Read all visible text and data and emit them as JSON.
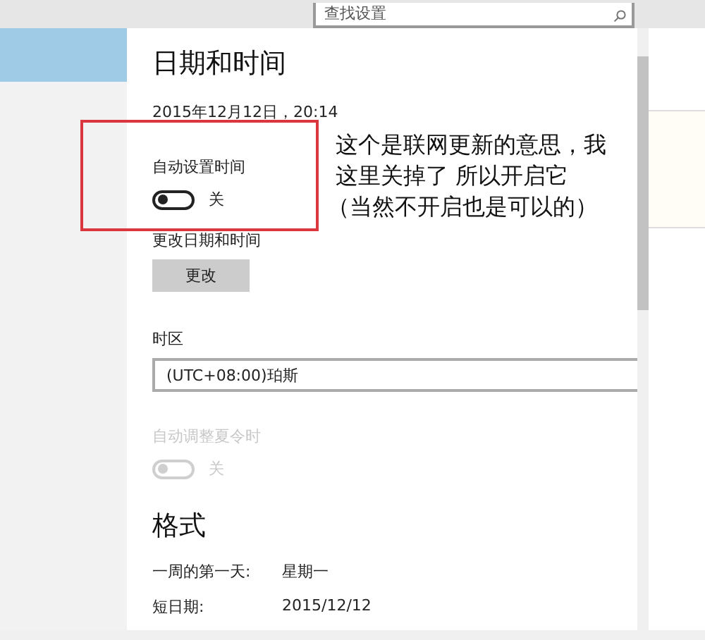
{
  "search": {
    "placeholder": "查找设置"
  },
  "sidebar": {
    "items": [
      {
        "selected": true
      }
    ]
  },
  "page": {
    "title": "日期和时间",
    "current_time": "2015年12月12日，20:14",
    "toggles": [
      {
        "label": "自动设置时间",
        "on": false,
        "disabled": false,
        "state_text": "关"
      }
    ],
    "change": {
      "label": "更改日期和时间",
      "button": "更改"
    },
    "timezone": {
      "label": "时区",
      "value": "(UTC+08:00)珀斯"
    },
    "dst": {
      "label": "自动调整夏令时",
      "on": false,
      "disabled": true,
      "state_text": "关"
    },
    "format": {
      "title": "格式",
      "rows": [
        {
          "label": "一周的第一天:",
          "value": "星期一"
        },
        {
          "label": "短日期:",
          "value": "2015/12/12"
        }
      ]
    }
  },
  "annotation": {
    "lines": [
      "这个是联网更新的意思，我",
      "这里关掉了 所以开启它",
      "（当然不开启也是可以的）"
    ]
  }
}
